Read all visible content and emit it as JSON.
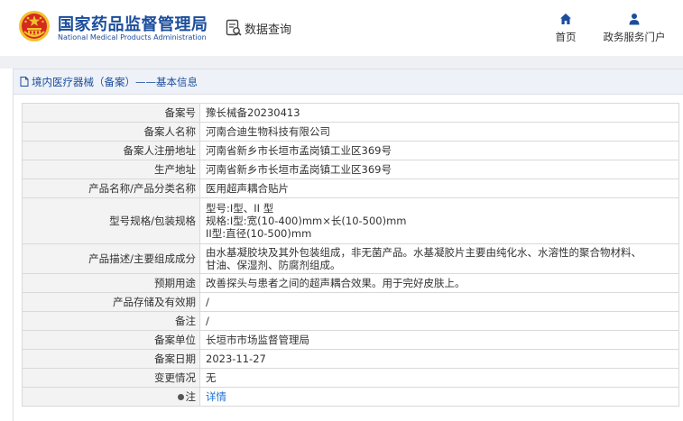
{
  "header": {
    "title_cn": "国家药品监督管理局",
    "title_en": "National Medical Products Administration",
    "data_query": "数据查询",
    "nav": {
      "home": "首页",
      "gov_portal": "政务服务门户"
    }
  },
  "panel": {
    "title": "境内医疗器械（备案）——基本信息"
  },
  "record": {
    "rows": [
      {
        "label": "备案号",
        "value": "豫长械备20230413"
      },
      {
        "label": "备案人名称",
        "value": "河南合迪生物科技有限公司"
      },
      {
        "label": "备案人注册地址",
        "value": "河南省新乡市长垣市孟岗镇工业区369号"
      },
      {
        "label": "生产地址",
        "value": "河南省新乡市长垣市孟岗镇工业区369号"
      },
      {
        "label": "产品名称/产品分类名称",
        "value": "医用超声耦合贴片"
      },
      {
        "label": "型号规格/包装规格",
        "lines": [
          "型号:I型、II 型",
          "规格:I型:宽(10-400)mm×长(10-500)mm",
          "II型:直径(10-500)mm"
        ]
      },
      {
        "label": "产品描述/主要组成成分",
        "lines": [
          "由水基凝胶块及其外包装组成，非无菌产品。水基凝胶片主要由纯化水、水溶性的聚合物材料、",
          "甘油、保湿剂、防腐剂组成。"
        ]
      },
      {
        "label": "预期用途",
        "value": "改善探头与患者之间的超声耦合效果。用于完好皮肤上。"
      },
      {
        "label": "产品存储及有效期",
        "value": "/"
      },
      {
        "label": "备注",
        "value": "/"
      },
      {
        "label": "备案单位",
        "value": "长垣市市场监督管理局"
      },
      {
        "label": "备案日期",
        "value": "2023-11-27"
      },
      {
        "label": "变更情况",
        "value": "无"
      },
      {
        "label": "注",
        "value": "详情"
      }
    ]
  },
  "colors": {
    "brand_blue": "#1b4d9c",
    "link_blue": "#1b6fd6",
    "emblem_red": "#d42a20",
    "emblem_gold": "#f2c12e"
  },
  "icons": {
    "emblem": "national-emblem",
    "data_query": "search-document-icon",
    "home": "home-icon",
    "gov_portal": "user-icon",
    "panel_title": "document-icon",
    "note": "dot-icon"
  }
}
